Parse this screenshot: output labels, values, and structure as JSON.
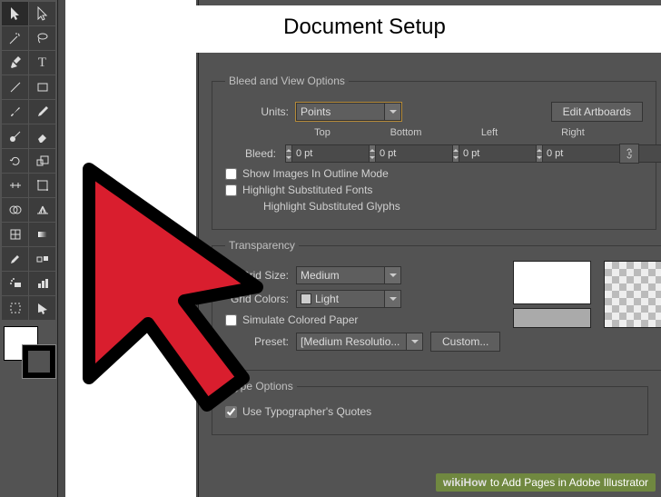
{
  "panel_title": "Document Setup",
  "sections": {
    "bleed": {
      "legend": "Bleed and View Options",
      "units_label": "Units:",
      "units_value": "Points",
      "edit_artboards": "Edit Artboards",
      "bleed_label": "Bleed:",
      "headers": {
        "top": "Top",
        "bottom": "Bottom",
        "left": "Left",
        "right": "Right"
      },
      "values": {
        "top": "0 pt",
        "bottom": "0 pt",
        "left": "0 pt",
        "right": "0 pt"
      },
      "check_outline": "Show Images In Outline Mode",
      "check_fonts": "Highlight Substituted Fonts",
      "check_glyphs": "Highlight Substituted Glyphs"
    },
    "transparency": {
      "legend": "Transparency",
      "grid_size_label": "Grid Size:",
      "grid_size_value": "Medium",
      "grid_colors_label": "Grid Colors:",
      "grid_colors_value": "Light",
      "simulate_label": "Simulate Colored Paper",
      "preset_label": "Preset:",
      "preset_value": "[Medium Resolutio...",
      "custom_btn": "Custom..."
    },
    "type": {
      "legend": "Type Options",
      "typographer": "Use Typographer's Quotes"
    }
  },
  "watermark": {
    "brand": "wikiHow",
    "text": " to Add Pages in Adobe Illustrator"
  }
}
